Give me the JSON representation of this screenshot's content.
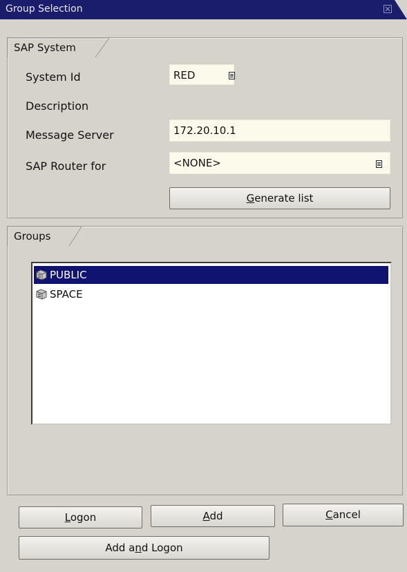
{
  "window": {
    "title": "Group Selection"
  },
  "sap_system": {
    "legend": "SAP System",
    "system_id_label": "System Id",
    "system_id_value": "RED",
    "description_label": "Description",
    "message_server_label": "Message Server",
    "message_server_value": "172.20.10.1",
    "router_label": "SAP Router for",
    "router_value": "<NONE>",
    "generate_button": {
      "prefix": "",
      "mnemonic": "G",
      "suffix": "enerate list"
    }
  },
  "groups": {
    "legend": "Groups",
    "items": [
      {
        "label": "PUBLIC",
        "selected": true
      },
      {
        "label": "SPACE",
        "selected": false
      }
    ]
  },
  "buttons": {
    "logon": {
      "prefix": "",
      "mnemonic": "L",
      "suffix": "ogon"
    },
    "add": {
      "prefix": "",
      "mnemonic": "A",
      "suffix": "dd"
    },
    "cancel": {
      "prefix": "",
      "mnemonic": "C",
      "suffix": "ancel"
    },
    "add_and_logon": {
      "prefix": "Add a",
      "mnemonic": "n",
      "suffix": "d Logon"
    }
  },
  "colors": {
    "title_bar": "#1a1d6c",
    "selection": "#111370",
    "input_background": "#fcfbeb",
    "dialog_background": "#d6d3cd"
  },
  "icons": {
    "value_help": "f4-help-icon",
    "group_item": "server-group-icon",
    "close": "close-icon"
  }
}
